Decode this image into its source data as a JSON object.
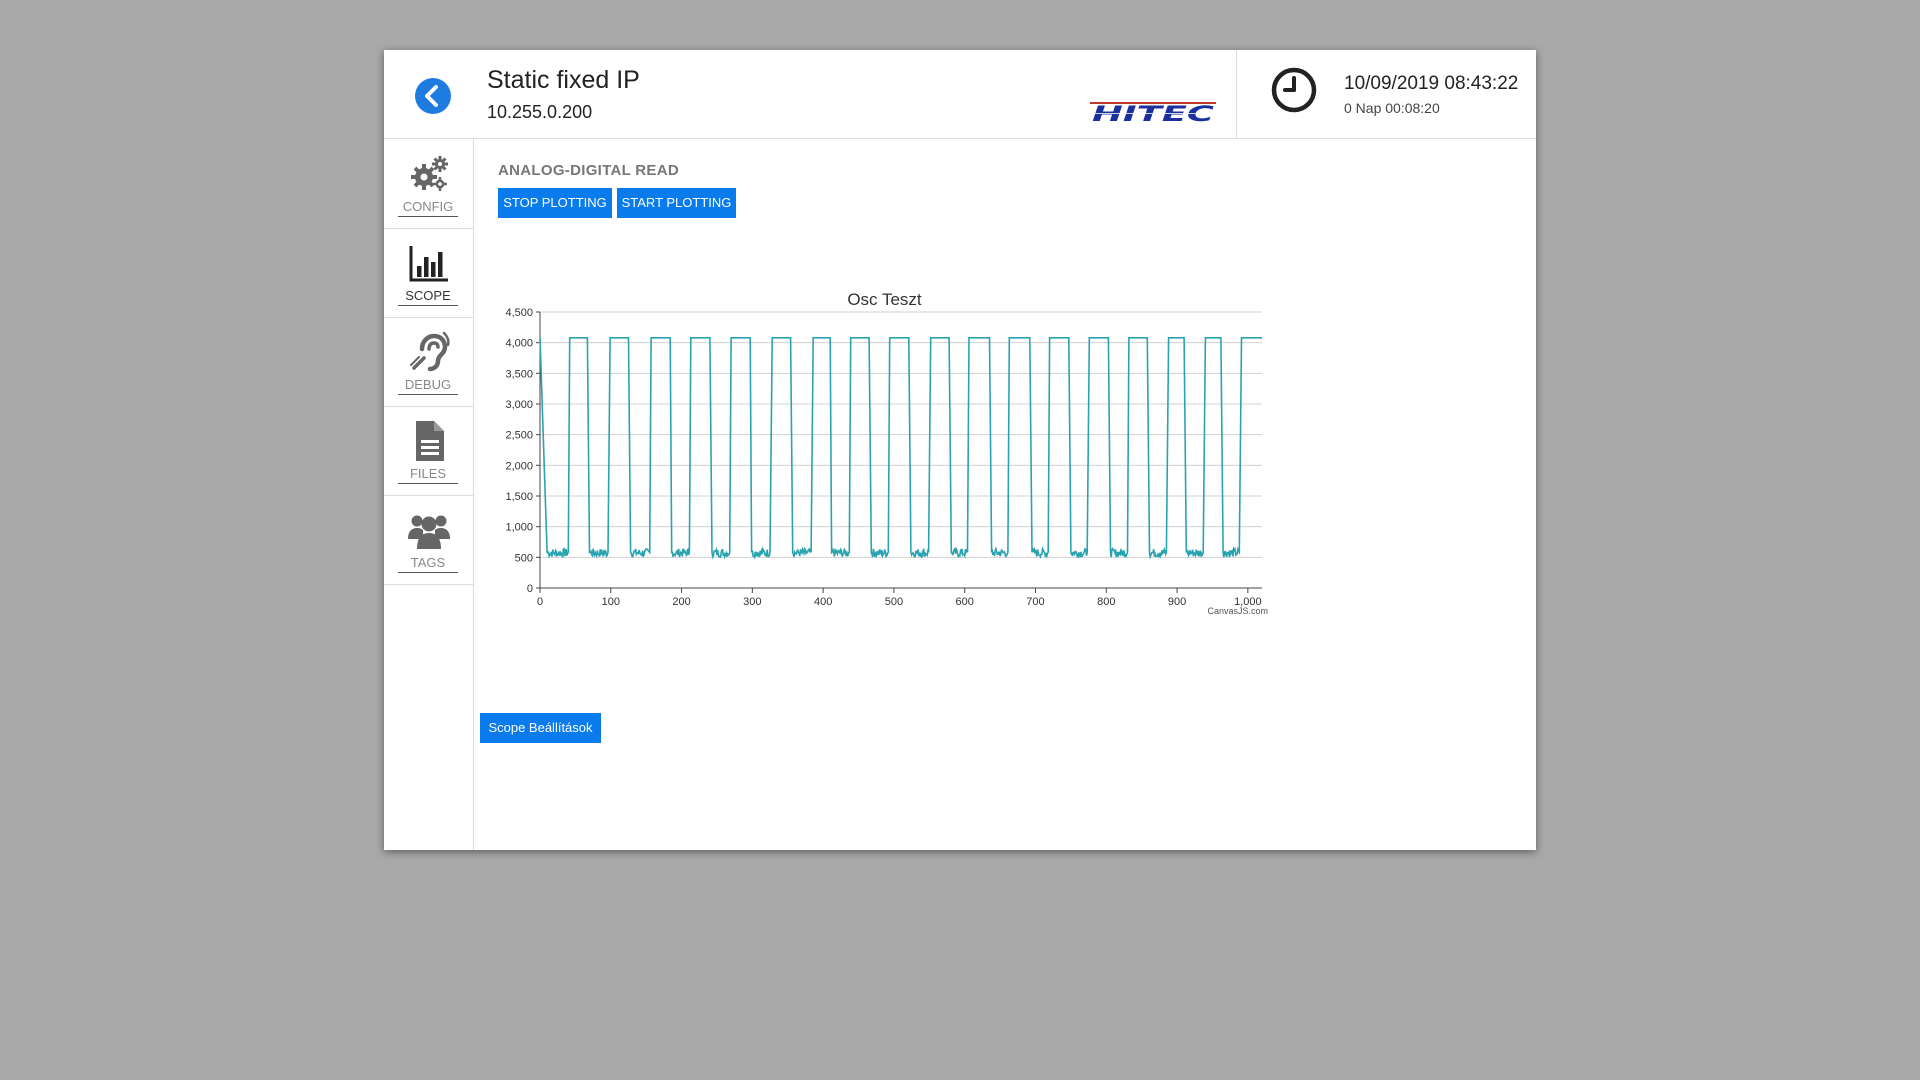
{
  "header": {
    "title": "Static fixed IP",
    "subtitle": "10.255.0.200",
    "logo_text": "HITEC",
    "datetime": "10/09/2019 08:43:22",
    "uptime": "0 Nap 00:08:20"
  },
  "sidebar": {
    "items": [
      {
        "label": "CONFIG",
        "icon": "gears-icon"
      },
      {
        "label": "SCOPE",
        "icon": "bar-chart-icon"
      },
      {
        "label": "DEBUG",
        "icon": "assistive-listening-icon"
      },
      {
        "label": "FILES",
        "icon": "file-icon"
      },
      {
        "label": "TAGS",
        "icon": "users-icon"
      }
    ],
    "active": "SCOPE"
  },
  "main": {
    "section_title": "ANALOG-DIGITAL READ",
    "stop_label": "STOP PLOTTING",
    "start_label": "START PLOTTING",
    "scope_settings_label": "Scope Beállítások"
  },
  "colors": {
    "accent": "#0a7bec",
    "series": "#2aa3b0",
    "background": "#a9a9a9"
  },
  "chart_data": {
    "type": "line",
    "title": "Osc Teszt",
    "xlim": [
      0,
      1000
    ],
    "ylim": [
      0,
      4500
    ],
    "x_ticks": [
      "0",
      "100",
      "200",
      "300",
      "400",
      "500",
      "600",
      "700",
      "800",
      "900",
      "1,000"
    ],
    "y_ticks": [
      "0",
      "500",
      "1,000",
      "1,500",
      "2,000",
      "2,500",
      "3,000",
      "3,500",
      "4,000",
      "4,500"
    ],
    "credit": "CanvasJS.com",
    "grid": true,
    "series": [
      {
        "high_value": 4080,
        "low_value": 580,
        "transitions": [
          {
            "x": 0,
            "y": 4080
          },
          {
            "x": 10,
            "y": 580
          },
          {
            "x": 40,
            "y": 580
          },
          {
            "x": 42,
            "y": 4080
          },
          {
            "x": 67,
            "y": 4080
          },
          {
            "x": 70,
            "y": 580
          },
          {
            "x": 96,
            "y": 580
          },
          {
            "x": 99,
            "y": 4080
          },
          {
            "x": 125,
            "y": 4080
          },
          {
            "x": 128,
            "y": 580
          },
          {
            "x": 155,
            "y": 580
          },
          {
            "x": 157,
            "y": 4080
          },
          {
            "x": 184,
            "y": 4080
          },
          {
            "x": 186,
            "y": 580
          },
          {
            "x": 211,
            "y": 580
          },
          {
            "x": 213,
            "y": 4080
          },
          {
            "x": 240,
            "y": 4080
          },
          {
            "x": 243,
            "y": 580
          },
          {
            "x": 268,
            "y": 580
          },
          {
            "x": 270,
            "y": 4080
          },
          {
            "x": 297,
            "y": 4080
          },
          {
            "x": 299,
            "y": 580
          },
          {
            "x": 325,
            "y": 580
          },
          {
            "x": 328,
            "y": 4080
          },
          {
            "x": 354,
            "y": 4080
          },
          {
            "x": 357,
            "y": 580
          },
          {
            "x": 383,
            "y": 580
          },
          {
            "x": 386,
            "y": 4080
          },
          {
            "x": 410,
            "y": 4080
          },
          {
            "x": 412,
            "y": 580
          },
          {
            "x": 437,
            "y": 580
          },
          {
            "x": 439,
            "y": 4080
          },
          {
            "x": 465,
            "y": 4080
          },
          {
            "x": 468,
            "y": 580
          },
          {
            "x": 492,
            "y": 580
          },
          {
            "x": 494,
            "y": 4080
          },
          {
            "x": 521,
            "y": 4080
          },
          {
            "x": 524,
            "y": 580
          },
          {
            "x": 549,
            "y": 580
          },
          {
            "x": 552,
            "y": 4080
          },
          {
            "x": 578,
            "y": 4080
          },
          {
            "x": 581,
            "y": 580
          },
          {
            "x": 604,
            "y": 580
          },
          {
            "x": 606,
            "y": 4080
          },
          {
            "x": 635,
            "y": 4080
          },
          {
            "x": 638,
            "y": 580
          },
          {
            "x": 661,
            "y": 580
          },
          {
            "x": 663,
            "y": 4080
          },
          {
            "x": 692,
            "y": 4080
          },
          {
            "x": 695,
            "y": 580
          },
          {
            "x": 718,
            "y": 580
          },
          {
            "x": 720,
            "y": 4080
          },
          {
            "x": 747,
            "y": 4080
          },
          {
            "x": 750,
            "y": 580
          },
          {
            "x": 773,
            "y": 580
          },
          {
            "x": 776,
            "y": 4080
          },
          {
            "x": 803,
            "y": 4080
          },
          {
            "x": 806,
            "y": 580
          },
          {
            "x": 830,
            "y": 580
          },
          {
            "x": 832,
            "y": 4080
          },
          {
            "x": 858,
            "y": 4080
          },
          {
            "x": 861,
            "y": 580
          },
          {
            "x": 885,
            "y": 580
          },
          {
            "x": 888,
            "y": 4080
          },
          {
            "x": 910,
            "y": 4080
          },
          {
            "x": 913,
            "y": 580
          },
          {
            "x": 937,
            "y": 580
          },
          {
            "x": 940,
            "y": 4080
          },
          {
            "x": 962,
            "y": 4080
          },
          {
            "x": 965,
            "y": 580
          },
          {
            "x": 988,
            "y": 580
          },
          {
            "x": 991,
            "y": 4080
          },
          {
            "x": 1020,
            "y": 4080
          }
        ]
      }
    ]
  }
}
